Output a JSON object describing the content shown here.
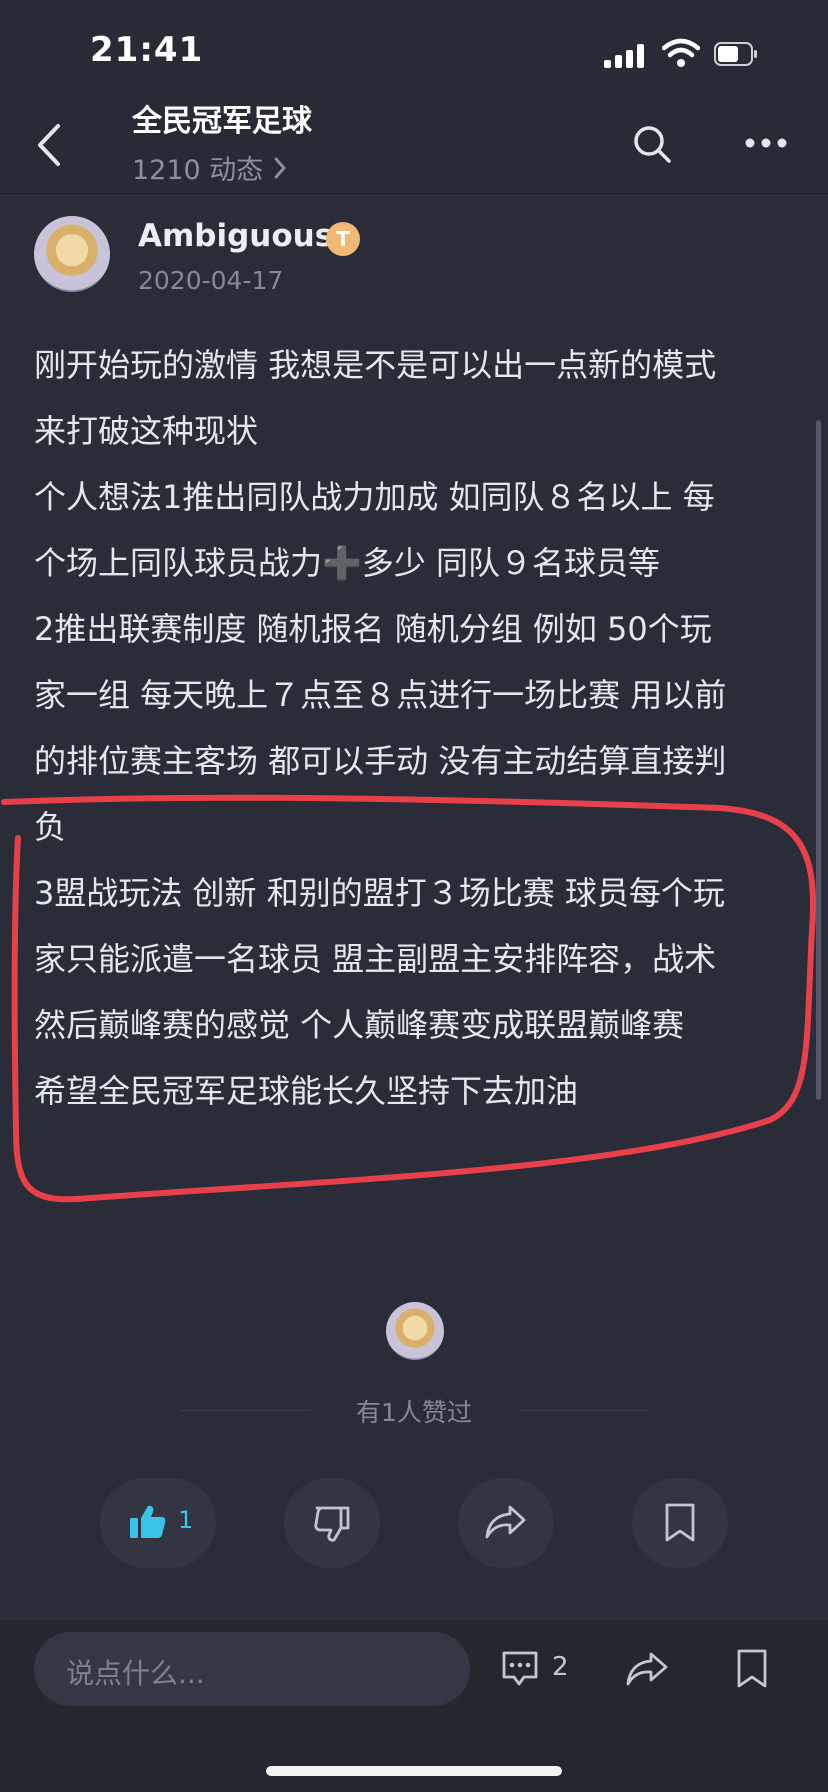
{
  "status_bar": {
    "time": "21:41"
  },
  "header": {
    "forum_name": "全民冠军足球",
    "dynamics": "1210 动态"
  },
  "post": {
    "author": "Ambiguous",
    "badge": "T",
    "date": "2020-04-17",
    "lines": [
      "刚开始玩的激情 我想是不是可以出一点新的模式",
      "来打破这种现状",
      "个人想法1推出同队战力加成 如同队８名以上 每",
      "个场上同队球员战力➕多少 同队９名球员等",
      "2推出联赛制度 随机报名 随机分组 例如 50个玩",
      "家一组 每天晚上７点至８点进行一场比赛 用以前",
      "的排位赛主客场 都可以手动 没有主动结算直接判",
      "负",
      "3盟战玩法 创新  和别的盟打３场比赛 球员每个玩",
      "家只能派遣一名球员 盟主副盟主安排阵容，战术",
      "然后巅峰赛的感觉 个人巅峰赛变成联盟巅峰赛",
      "希望全民冠军足球能长久坚持下去加油"
    ]
  },
  "likes": {
    "summary": "有1人赞过",
    "like_count": "1"
  },
  "bottom_bar": {
    "comment_placeholder": "说点什么...",
    "comment_count": "2"
  },
  "colors": {
    "accent": "#3cc3e8",
    "annotation": "#e8404a",
    "background": "#2a2c38"
  }
}
